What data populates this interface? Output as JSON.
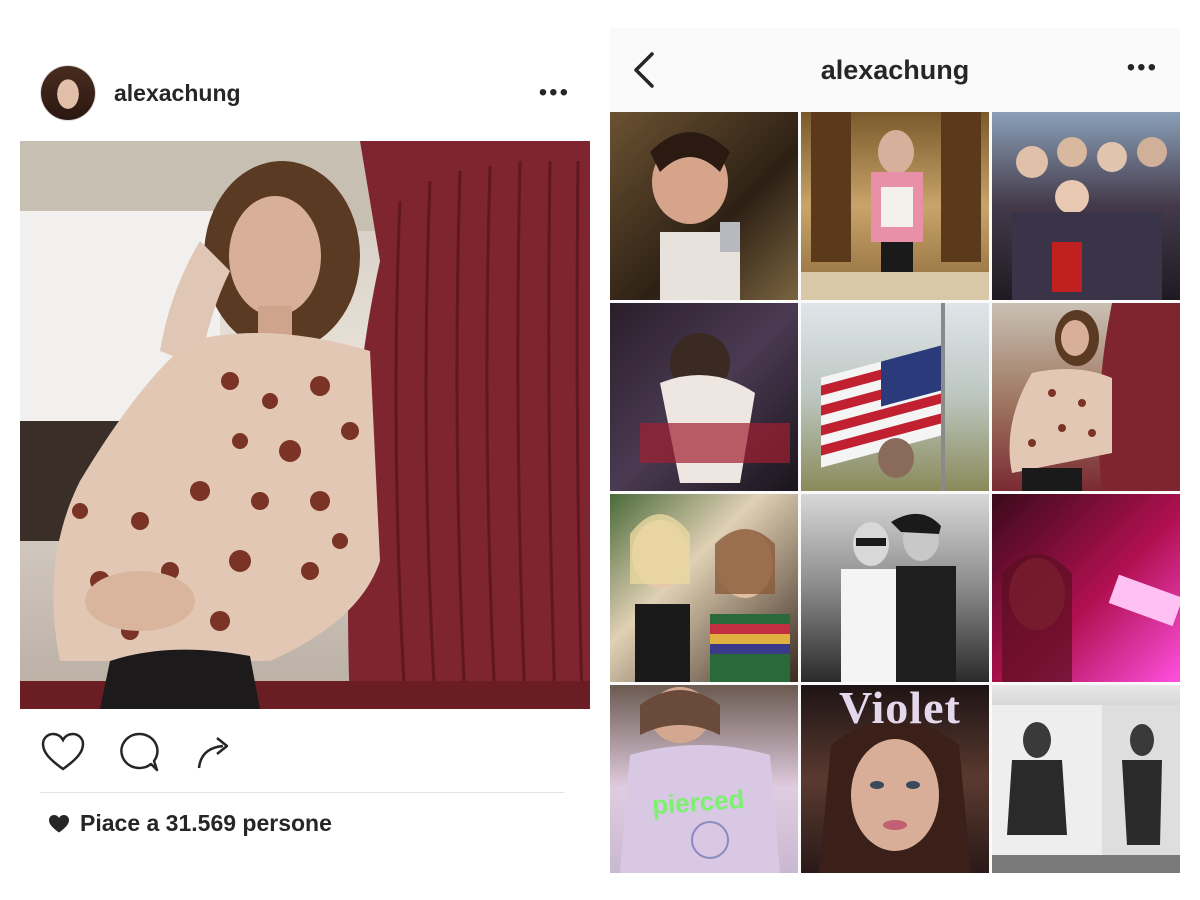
{
  "post": {
    "username": "alexachung",
    "more_label": "•••",
    "likes_text": "Piace a 31.569 persone",
    "actions": [
      "like-icon",
      "comment-icon",
      "share-icon"
    ]
  },
  "profile": {
    "title": "alexachung",
    "more_label": "•••",
    "grid": [
      {
        "id": 1,
        "caption": ""
      },
      {
        "id": 2,
        "caption": ""
      },
      {
        "id": 3,
        "caption": ""
      },
      {
        "id": 4,
        "caption": ""
      },
      {
        "id": 5,
        "caption": ""
      },
      {
        "id": 6,
        "caption": ""
      },
      {
        "id": 7,
        "caption": ""
      },
      {
        "id": 8,
        "caption": ""
      },
      {
        "id": 9,
        "caption": ""
      },
      {
        "id": 10,
        "caption": "pierced"
      },
      {
        "id": 11,
        "caption": "Violet"
      },
      {
        "id": 12,
        "caption": ""
      }
    ]
  },
  "colors": {
    "text": "#262626",
    "background": "#ffffff",
    "nav_background": "#fafafa",
    "divider": "#e3e3e3"
  }
}
